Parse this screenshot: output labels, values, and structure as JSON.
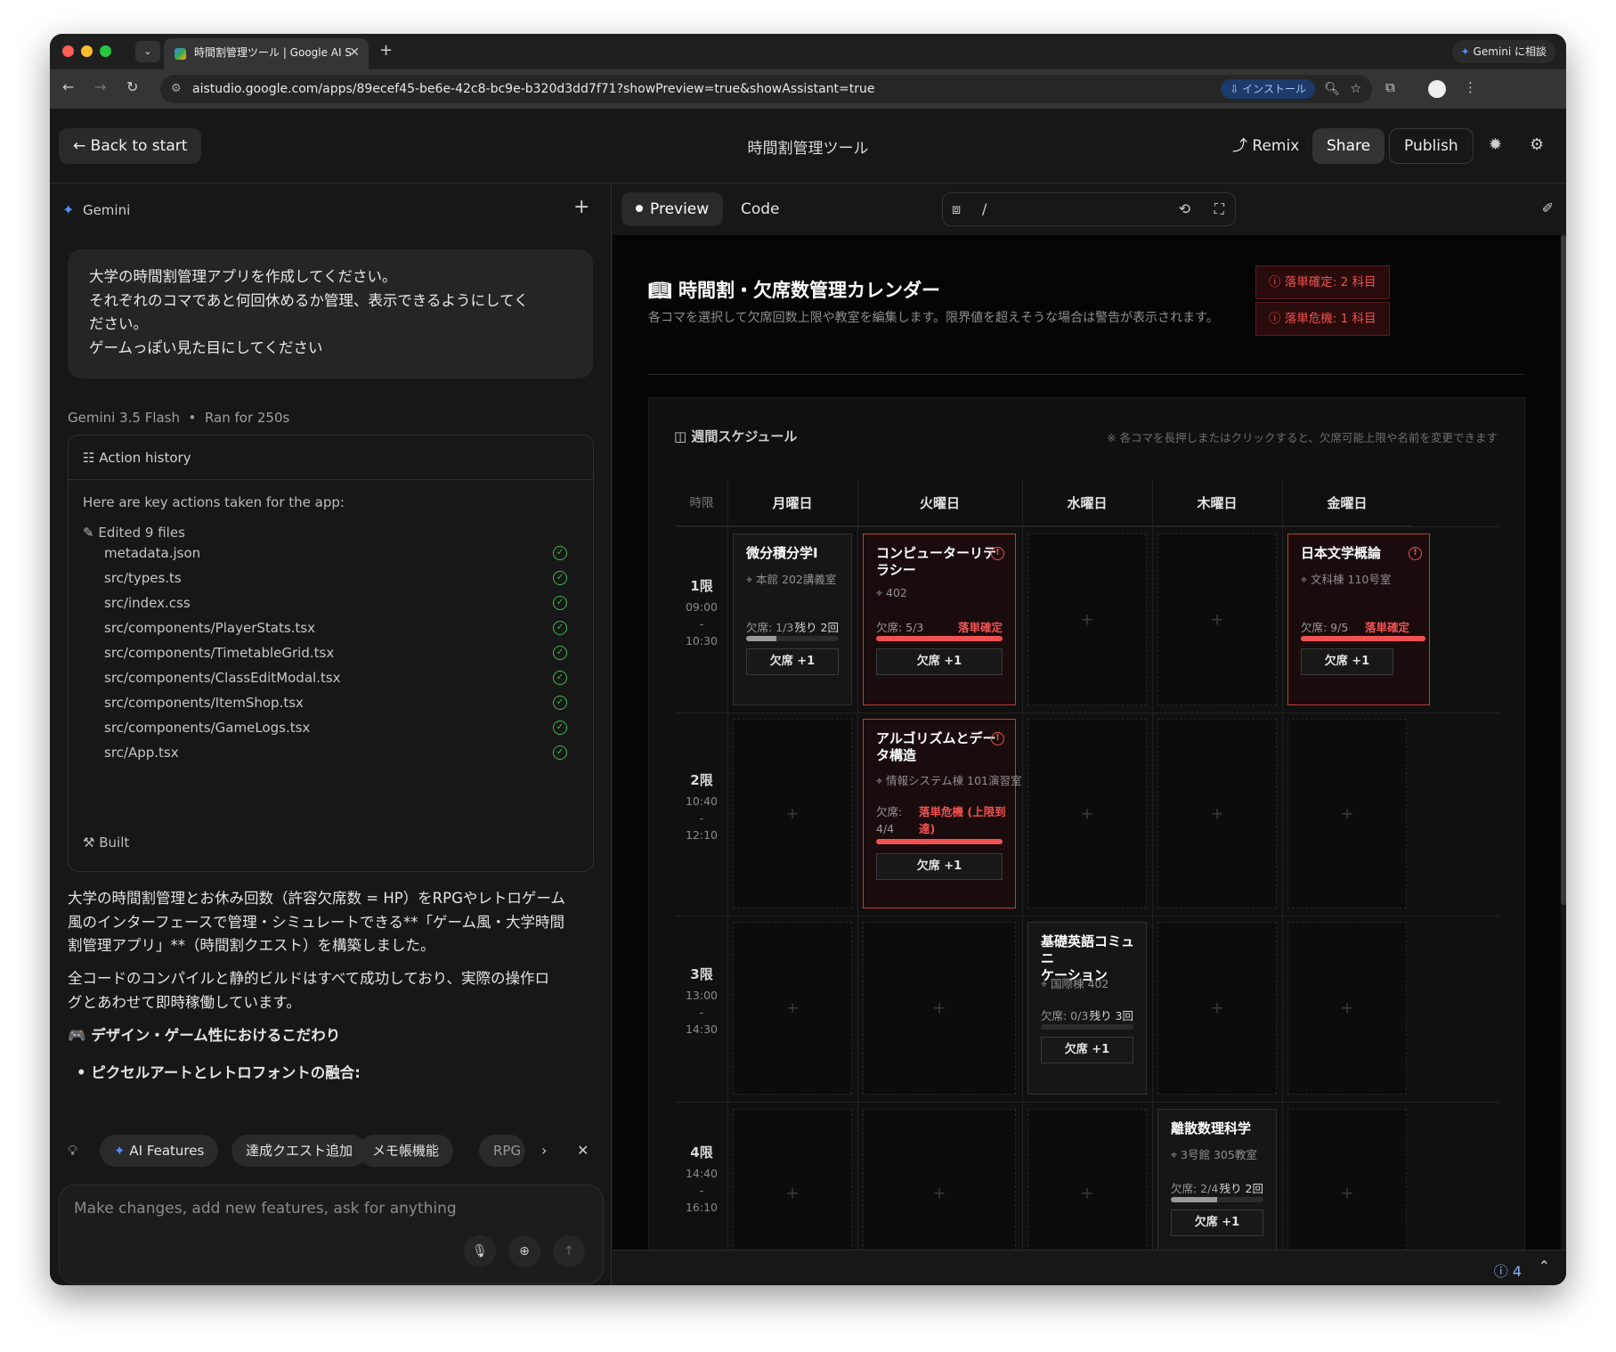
{
  "browser": {
    "tab_title": "時間割管理ツール | Google AI S",
    "url": "aistudio.google.com/apps/89ecef45-be6e-42c8-bc9e-b320d3dd7f71?showPreview=true&showAssistant=true",
    "install_label": "インストール",
    "gemini_chip": "Gemini に相談"
  },
  "header": {
    "back_label": "Back to start",
    "title": "時間割管理ツール",
    "remix_label": "Remix",
    "share_label": "Share",
    "publish_label": "Publish"
  },
  "chat": {
    "assistant_name": "Gemini",
    "prompt_lines": [
      "大学の時間割管理アプリを作成してください。",
      "それぞれのコマであと何回休めるか管理、表示できるようにしてく",
      "ださい。",
      "ゲームっぽい見た目にしてください"
    ],
    "model": "Gemini 3.5 Flash",
    "runtime": "Ran for 250s",
    "history_title": "Action history",
    "key_actions": "Here are key actions taken for the app:",
    "edited_label": "Edited 9 files",
    "files": [
      "metadata.json",
      "src/types.ts",
      "src/index.css",
      "src/components/PlayerStats.tsx",
      "src/components/TimetableGrid.tsx",
      "src/components/ClassEditModal.tsx",
      "src/components/ItemShop.tsx",
      "src/components/GameLogs.tsx",
      "src/App.tsx"
    ],
    "built_label": "Built",
    "response_p1_lines": [
      "大学の時間割管理とお休み回数（許容欠席数 = HP）をRPGやレトロゲーム",
      "風のインターフェースで管理・シミュレートできる**「ゲーム風・大学時間",
      "割管理アプリ」**（時間割クエスト）を構築しました。"
    ],
    "response_p2_lines": [
      "全コードのコンパイルと静的ビルドはすべて成功しており、実際の操作ロ",
      "グとあわせて即時稼働しています。"
    ],
    "response_heading": "🎮 デザイン・ゲーム性におけるこだわり",
    "response_bullet": "ピクセルアートとレトロフォントの融合:",
    "suggestions": [
      "AI Features",
      "達成クエスト追加",
      "メモ帳機能",
      "RPG"
    ],
    "input_placeholder": "Make changes, add new features, ask for anything"
  },
  "preview_bar": {
    "preview_label": "Preview",
    "code_label": "Code",
    "path": "/"
  },
  "app": {
    "title": "時間割・欠席数管理カレンダー",
    "subtitle": "各コマを選択して欠席回数上限や教室を編集します。限界値を超えそうな場合は警告が表示されます。",
    "badge_fail": "落単確定: 2 科目",
    "badge_danger": "落単危機: 1 科目",
    "schedule_title": "週間スケジュール",
    "schedule_note": "※ 各コマを長押しまたはクリックすると、欠席可能上限や名前を変更できます",
    "col_period": "時限",
    "days": [
      "月曜日",
      "火曜日",
      "水曜日",
      "木曜日",
      "金曜日"
    ],
    "periods": [
      {
        "name": "1限",
        "start": "09:00",
        "end": "10:30"
      },
      {
        "name": "2限",
        "start": "10:40",
        "end": "12:10"
      },
      {
        "name": "3限",
        "start": "13:00",
        "end": "14:30"
      },
      {
        "name": "4限",
        "start": "14:40",
        "end": "16:10"
      }
    ],
    "add_mark": "+",
    "absent_button": "欠席 +1",
    "classes": {
      "c1": {
        "name": "微分積分学I",
        "room": "本館 202講義室",
        "absent": "欠席: 1/3",
        "status": "残り 2回",
        "progress": 0.33
      },
      "c2": {
        "name_l1": "コンピューターリテ",
        "name_l2": "ラシー",
        "room": "402",
        "absent": "欠席: 5/3",
        "status": "落単確定",
        "progress": 1.0
      },
      "c3": {
        "name": "日本文学概論",
        "room": "文科棟 110号室",
        "absent": "欠席: 9/5",
        "status": "落単確定",
        "progress": 1.0
      },
      "c4": {
        "name_l1": "アルゴリズムとデー",
        "name_l2": "タ構造",
        "room": "情報システム棟 101演習室",
        "absent_l1": "欠席:",
        "absent_l2": "4/4",
        "status_l1": "落単危機 (上限到",
        "status_l2": "達)",
        "progress": 1.0
      },
      "c5": {
        "name_l1": "基礎英語コミュニ",
        "name_l2": "ケーション",
        "room": "国際棟 402",
        "absent": "欠席: 0/3",
        "status": "残り 3回",
        "progress": 0.0
      },
      "c6": {
        "name": "離散数理科学",
        "room": "3号館 305教室",
        "absent": "欠席: 2/4",
        "status": "残り 2回",
        "progress": 0.5
      }
    }
  },
  "status_bar": {
    "issue_count": "4"
  }
}
